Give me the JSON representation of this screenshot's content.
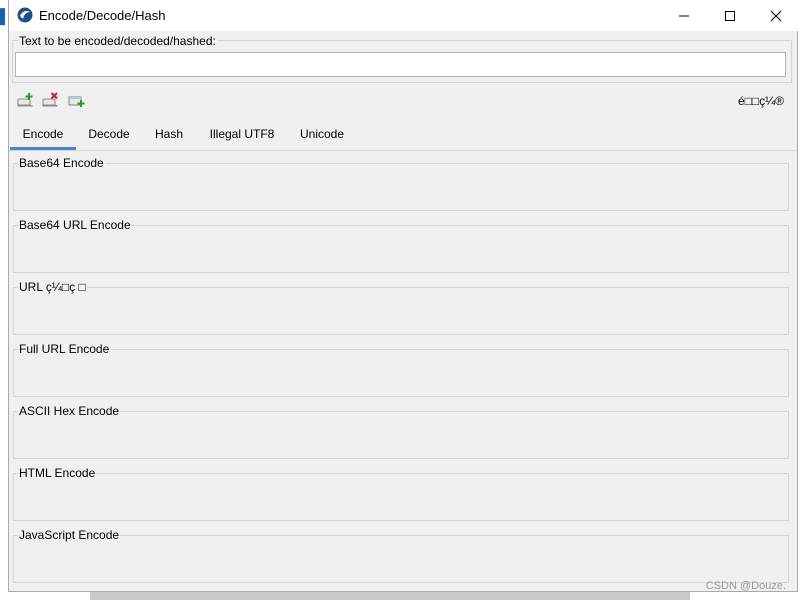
{
  "window": {
    "title": "Encode/Decode/Hash",
    "controls": {
      "minimize_icon": "minimize-icon",
      "maximize_icon": "maximize-icon",
      "close_icon": "close-icon"
    }
  },
  "input": {
    "label": "Text to be encoded/decoded/hashed:",
    "value": "",
    "placeholder": ""
  },
  "toolbar": {
    "icons": [
      "add-tab-icon",
      "remove-tab-icon",
      "add-item-icon"
    ],
    "corner_text": "é□□ç¼®"
  },
  "tabs": [
    {
      "label": "Encode",
      "active": true
    },
    {
      "label": "Decode",
      "active": false
    },
    {
      "label": "Hash",
      "active": false
    },
    {
      "label": "Illegal UTF8",
      "active": false
    },
    {
      "label": "Unicode",
      "active": false
    }
  ],
  "sections": [
    {
      "label": "Base64 Encode",
      "value": ""
    },
    {
      "label": "Base64 URL Encode",
      "value": ""
    },
    {
      "label": "URL ç¼□ç □",
      "value": ""
    },
    {
      "label": "Full URL Encode",
      "value": ""
    },
    {
      "label": "ASCII Hex Encode",
      "value": ""
    },
    {
      "label": "HTML Encode",
      "value": ""
    },
    {
      "label": "JavaScript Encode",
      "value": ""
    }
  ],
  "watermark": "CSDN @Douze.",
  "colors": {
    "tab_accent": "#3c8bd9",
    "window_bg": "#f0f0f0",
    "titlebar_bg": "#ffffff"
  }
}
